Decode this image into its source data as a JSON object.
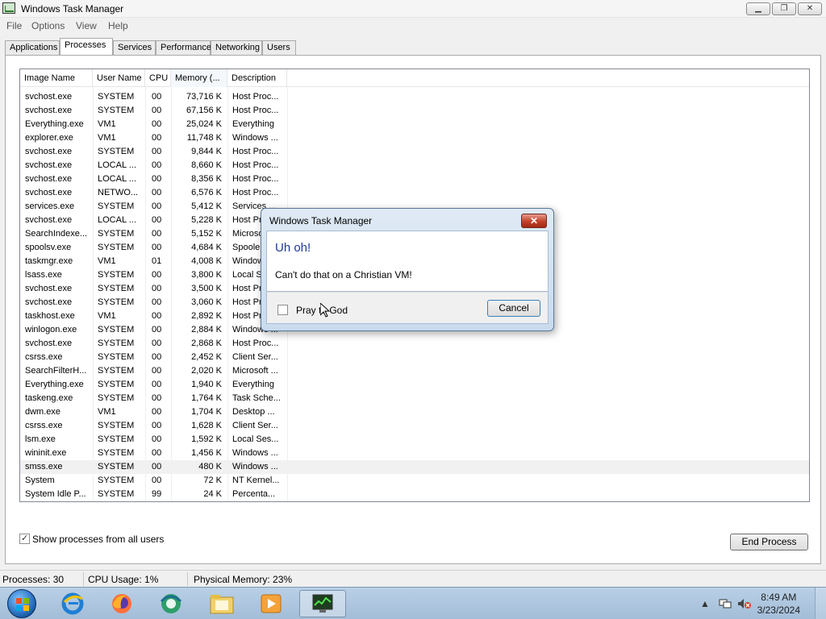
{
  "window": {
    "title": "Windows Task Manager",
    "minimize": "▁",
    "restore": "❐",
    "close": "✕"
  },
  "menu": [
    "File",
    "Options",
    "View",
    "Help"
  ],
  "tabs": [
    "Applications",
    "Processes",
    "Services",
    "Performance",
    "Networking",
    "Users"
  ],
  "active_tab": "Processes",
  "columns": [
    "Image Name",
    "User Name",
    "CPU",
    "Memory (...",
    "Description"
  ],
  "processes": [
    [
      "svchost.exe",
      "SYSTEM",
      "00",
      "73,716 K",
      "Host Proc..."
    ],
    [
      "svchost.exe",
      "SYSTEM",
      "00",
      "67,156 K",
      "Host Proc..."
    ],
    [
      "Everything.exe",
      "VM1",
      "00",
      "25,024 K",
      "Everything"
    ],
    [
      "explorer.exe",
      "VM1",
      "00",
      "11,748 K",
      "Windows ..."
    ],
    [
      "svchost.exe",
      "SYSTEM",
      "00",
      "9,844 K",
      "Host Proc..."
    ],
    [
      "svchost.exe",
      "LOCAL ...",
      "00",
      "8,660 K",
      "Host Proc..."
    ],
    [
      "svchost.exe",
      "LOCAL ...",
      "00",
      "8,356 K",
      "Host Proc..."
    ],
    [
      "svchost.exe",
      "NETWO...",
      "00",
      "6,576 K",
      "Host Proc..."
    ],
    [
      "services.exe",
      "SYSTEM",
      "00",
      "5,412 K",
      "Services ..."
    ],
    [
      "svchost.exe",
      "LOCAL ...",
      "00",
      "5,228 K",
      "Host Proc..."
    ],
    [
      "SearchIndexe...",
      "SYSTEM",
      "00",
      "5,152 K",
      "Microsoft ..."
    ],
    [
      "spoolsv.exe",
      "SYSTEM",
      "00",
      "4,684 K",
      "Spooler ..."
    ],
    [
      "taskmgr.exe",
      "VM1",
      "01",
      "4,008 K",
      "Windows ..."
    ],
    [
      "lsass.exe",
      "SYSTEM",
      "00",
      "3,800 K",
      "Local Sec..."
    ],
    [
      "svchost.exe",
      "SYSTEM",
      "00",
      "3,500 K",
      "Host Proc..."
    ],
    [
      "svchost.exe",
      "SYSTEM",
      "00",
      "3,060 K",
      "Host Proc..."
    ],
    [
      "taskhost.exe",
      "VM1",
      "00",
      "2,892 K",
      "Host Proc..."
    ],
    [
      "winlogon.exe",
      "SYSTEM",
      "00",
      "2,884 K",
      "Windows ..."
    ],
    [
      "svchost.exe",
      "SYSTEM",
      "00",
      "2,868 K",
      "Host Proc..."
    ],
    [
      "csrss.exe",
      "SYSTEM",
      "00",
      "2,452 K",
      "Client Ser..."
    ],
    [
      "SearchFilterH...",
      "SYSTEM",
      "00",
      "2,020 K",
      "Microsoft ..."
    ],
    [
      "Everything.exe",
      "SYSTEM",
      "00",
      "1,940 K",
      "Everything"
    ],
    [
      "taskeng.exe",
      "SYSTEM",
      "00",
      "1,764 K",
      "Task Sche..."
    ],
    [
      "dwm.exe",
      "VM1",
      "00",
      "1,704 K",
      "Desktop ..."
    ],
    [
      "csrss.exe",
      "SYSTEM",
      "00",
      "1,628 K",
      "Client Ser..."
    ],
    [
      "lsm.exe",
      "SYSTEM",
      "00",
      "1,592 K",
      "Local Ses..."
    ],
    [
      "wininit.exe",
      "SYSTEM",
      "00",
      "1,456 K",
      "Windows ..."
    ],
    [
      "smss.exe",
      "SYSTEM",
      "00",
      "480 K",
      "Windows ..."
    ],
    [
      "System",
      "SYSTEM",
      "00",
      "72 K",
      "NT Kernel..."
    ],
    [
      "System Idle P...",
      "SYSTEM",
      "99",
      "24 K",
      "Percenta..."
    ]
  ],
  "selected_row": 27,
  "show_all": {
    "label": "Show processes from all users",
    "checked": true
  },
  "end_process": "End Process",
  "status": {
    "processes": "Processes: 30",
    "cpu": "CPU Usage: 1%",
    "memory": "Physical Memory: 23%"
  },
  "dialog": {
    "title": "Windows Task Manager",
    "heading": "Uh oh!",
    "message": "Can't do that on a Christian VM!",
    "checkbox_label": "Pray to God",
    "checkbox_checked": false,
    "cancel": "Cancel"
  },
  "taskbar": {
    "icons": [
      "internet-explorer-icon",
      "firefox-icon",
      "browser-icon",
      "file-explorer-icon",
      "media-player-icon",
      "task-manager-icon"
    ],
    "time": "8:49 AM",
    "date": "3/23/2024"
  },
  "colors": {
    "accent": "#1e3a96",
    "taskbar": "#a3bdd8",
    "close_red": "#c2402a"
  }
}
